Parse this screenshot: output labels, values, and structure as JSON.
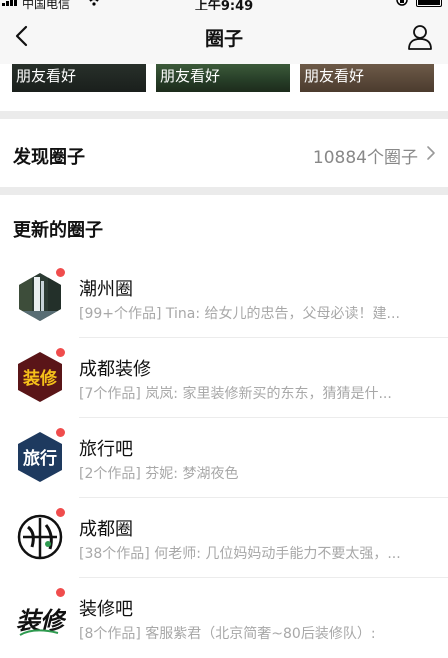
{
  "status_bar": {
    "carrier": "中国电信",
    "time": "上午9:49"
  },
  "nav": {
    "title": "圈子"
  },
  "cards": [
    {
      "label": "朋友看好"
    },
    {
      "label": "朋友看好"
    },
    {
      "label": "朋友看好"
    }
  ],
  "discover": {
    "label": "发现圈子",
    "count": "10884个圈子"
  },
  "section": {
    "title": "更新的圈子"
  },
  "circles": [
    {
      "name": "潮州圈",
      "desc": "[99+个作品] Tina: 给女儿的忠告，父母必读！建...",
      "unread": true,
      "icon": "waterfall-hexagon-avatar"
    },
    {
      "name": "成都装修",
      "desc": "[7个作品] 岚岚: 家里装修新买的东东，猜猜是什...",
      "unread": true,
      "icon": "renovation-hexagon-avatar",
      "avatar_text": "装修"
    },
    {
      "name": "旅行吧",
      "desc": "[2个作品] 芬妮: 梦湖夜色",
      "unread": true,
      "icon": "travel-hexagon-avatar",
      "avatar_text": "旅行"
    },
    {
      "name": "成都圈",
      "desc": "[38个作品] 何老师: 几位妈妈动手能力不要太强，...",
      "unread": true,
      "icon": "chengdu-calligraphy-avatar"
    },
    {
      "name": "装修吧",
      "desc": "[8个作品] 客服紫君（北京简奢~80后装修队）:",
      "unread": true,
      "icon": "renovation-calligraphy-avatar",
      "avatar_text": "装修"
    }
  ],
  "colors": {
    "unread_dot": "#f04d4d",
    "separator": "#ebebeb",
    "nav_bg": "#f7f7f7",
    "secondary_text": "#a8a8a8"
  }
}
